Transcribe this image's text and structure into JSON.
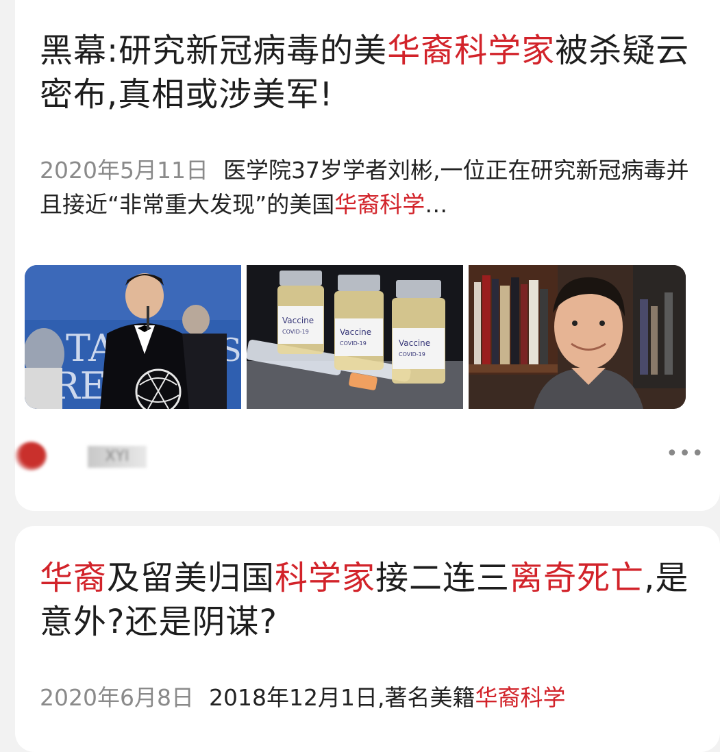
{
  "articles": [
    {
      "title": {
        "part1": "黑幕:研究新冠病毒的美",
        "hl1": "华裔科学家",
        "part2": "被杀疑云密布,真相或涉美军!"
      },
      "date": "2020年5月11日",
      "summary": {
        "part1": "医学院37岁学者刘彬,一位正在研究新冠病毒并且接近“非常重大发现”的美国",
        "hl1": "华裔科学",
        "part2": "…"
      },
      "images": [
        {
          "icon": "award-ceremony-photo",
          "text1": "TAI",
          "text2": "RE",
          "text3": "CS"
        },
        {
          "icon": "vaccine-vials-photo",
          "vial_label1": "Vaccine",
          "vial_label2": "COVID-19"
        },
        {
          "icon": "portrait-photo"
        }
      ],
      "source": {
        "name_icon": "source-avatar",
        "name": "XYI"
      },
      "more_icon": "more-dots-icon",
      "more_label": "•••"
    },
    {
      "title": {
        "hl1": "华裔",
        "part1": "及留美归国",
        "hl2": "科学家",
        "part2": "接二连三",
        "hl3": "离奇死亡",
        "part3": ",是意外?还是阴谋?"
      },
      "date": "2020年6月8日",
      "summary": {
        "part1": "2018年12月1日,著名美籍",
        "hl1": "华裔科学"
      }
    }
  ],
  "colors": {
    "highlight": "#d2232a",
    "date": "#8a8a8a",
    "background": "#f2f2f2"
  }
}
